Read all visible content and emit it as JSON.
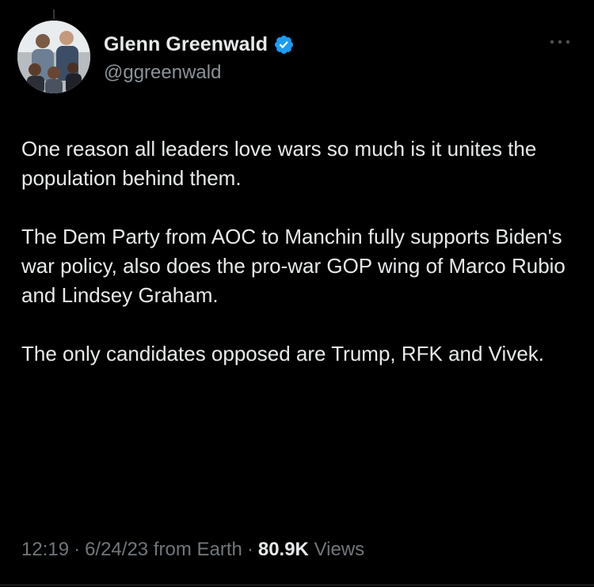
{
  "user": {
    "display_name": "Glenn Greenwald",
    "handle": "@ggreenwald",
    "verified": true,
    "avatar_icon": "family-photo-avatar",
    "verified_icon": "verified-badge-icon",
    "verified_color": "#1d9bf0"
  },
  "tweet": {
    "paragraphs": [
      "One reason all leaders love wars so much is it unites the population behind them.",
      "The Dem Party from AOC to Manchin fully supports Biden's war policy, also does the pro-war GOP wing of Marco Rubio and Lindsey Graham.",
      "The only candidates opposed are Trump, RFK and Vivek."
    ]
  },
  "meta": {
    "time": "12:19",
    "date": "6/24/23",
    "source": "from Earth",
    "separator": "·",
    "views_count": "80.9K",
    "views_label": "Views"
  },
  "colors": {
    "background": "#000000",
    "text": "#e7e9ea",
    "secondary_text": "#71767b"
  },
  "icons": {
    "more": "more-horizontal-icon"
  }
}
